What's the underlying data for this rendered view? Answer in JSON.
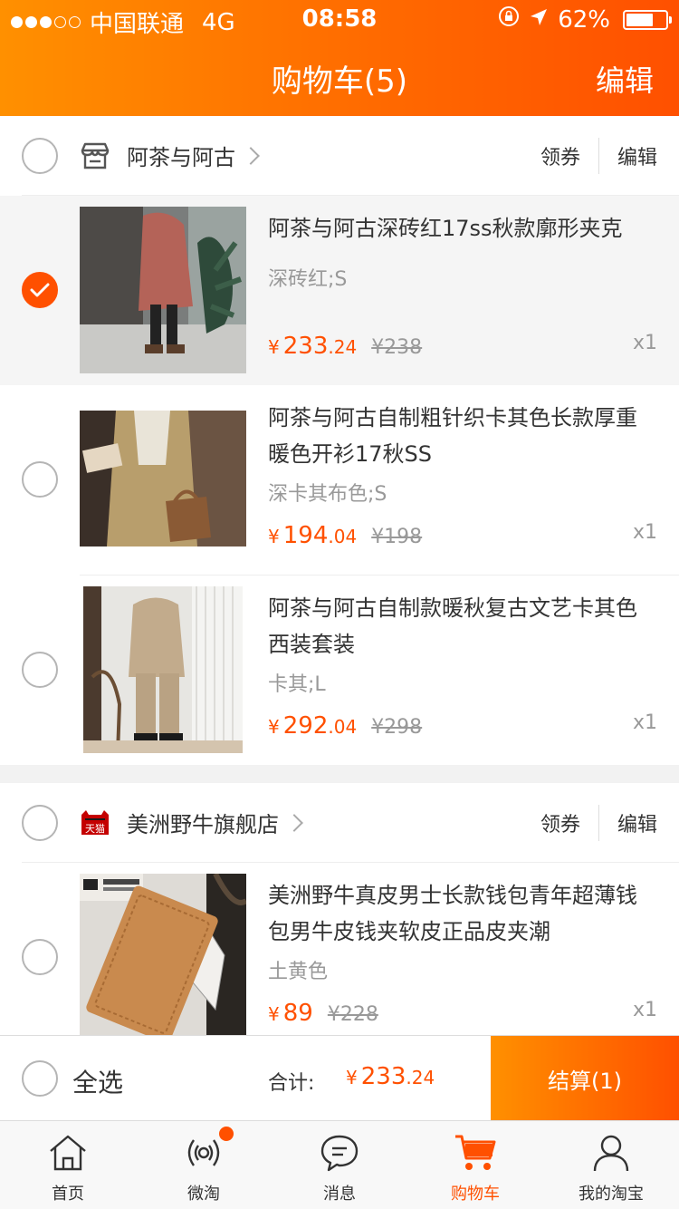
{
  "status_bar": {
    "carrier": "中国联通",
    "network": "4G",
    "time": "08:58",
    "battery": "62%"
  },
  "header": {
    "title": "购物车(5)",
    "edit": "编辑"
  },
  "stores": [
    {
      "name": "阿茶与阿古",
      "coupon": "领券",
      "edit": "编辑",
      "items": [
        {
          "title": "阿茶与阿古深砖红17ss秋款廓形夹克",
          "sku": "深砖红;S",
          "yen": "¥",
          "price_int": "233",
          "price_dec": ".24",
          "orig": "¥238",
          "qty": "x1",
          "selected": true
        },
        {
          "title": "阿茶与阿古自制粗针织卡其色长款厚重暖色开衫17秋SS",
          "sku": "深卡其布色;S",
          "yen": "¥",
          "price_int": "194",
          "price_dec": ".04",
          "orig": "¥198",
          "qty": "x1",
          "selected": false
        },
        {
          "title": "阿茶与阿古自制款暖秋复古文艺卡其色西装套装",
          "sku": "卡其;L",
          "yen": "¥",
          "price_int": "292",
          "price_dec": ".04",
          "orig": "¥298",
          "qty": "x1",
          "selected": false
        }
      ]
    },
    {
      "name": "美洲野牛旗舰店",
      "badge": "天猫",
      "coupon": "领券",
      "edit": "编辑",
      "items": [
        {
          "title": "美洲野牛真皮男士长款钱包青年超薄钱包男牛皮钱夹软皮正品皮夹潮",
          "sku": "土黄色",
          "yen": "¥",
          "price_int": "89",
          "price_dec": "",
          "orig": "¥228",
          "qty": "x1",
          "selected": false
        }
      ]
    }
  ],
  "footer": {
    "select_all": "全选",
    "total_label": "合计:",
    "total_yen": "¥",
    "total_int": "233",
    "total_dec": ".24",
    "checkout": "结算(1)"
  },
  "tabs": [
    {
      "label": "首页",
      "icon": "home-icon"
    },
    {
      "label": "微淘",
      "icon": "broadcast-icon"
    },
    {
      "label": "消息",
      "icon": "message-icon"
    },
    {
      "label": "购物车",
      "icon": "cart-icon",
      "active": true
    },
    {
      "label": "我的淘宝",
      "icon": "user-icon"
    }
  ],
  "colors": {
    "accent": "#ff5000",
    "header_start": "#ff9000"
  }
}
